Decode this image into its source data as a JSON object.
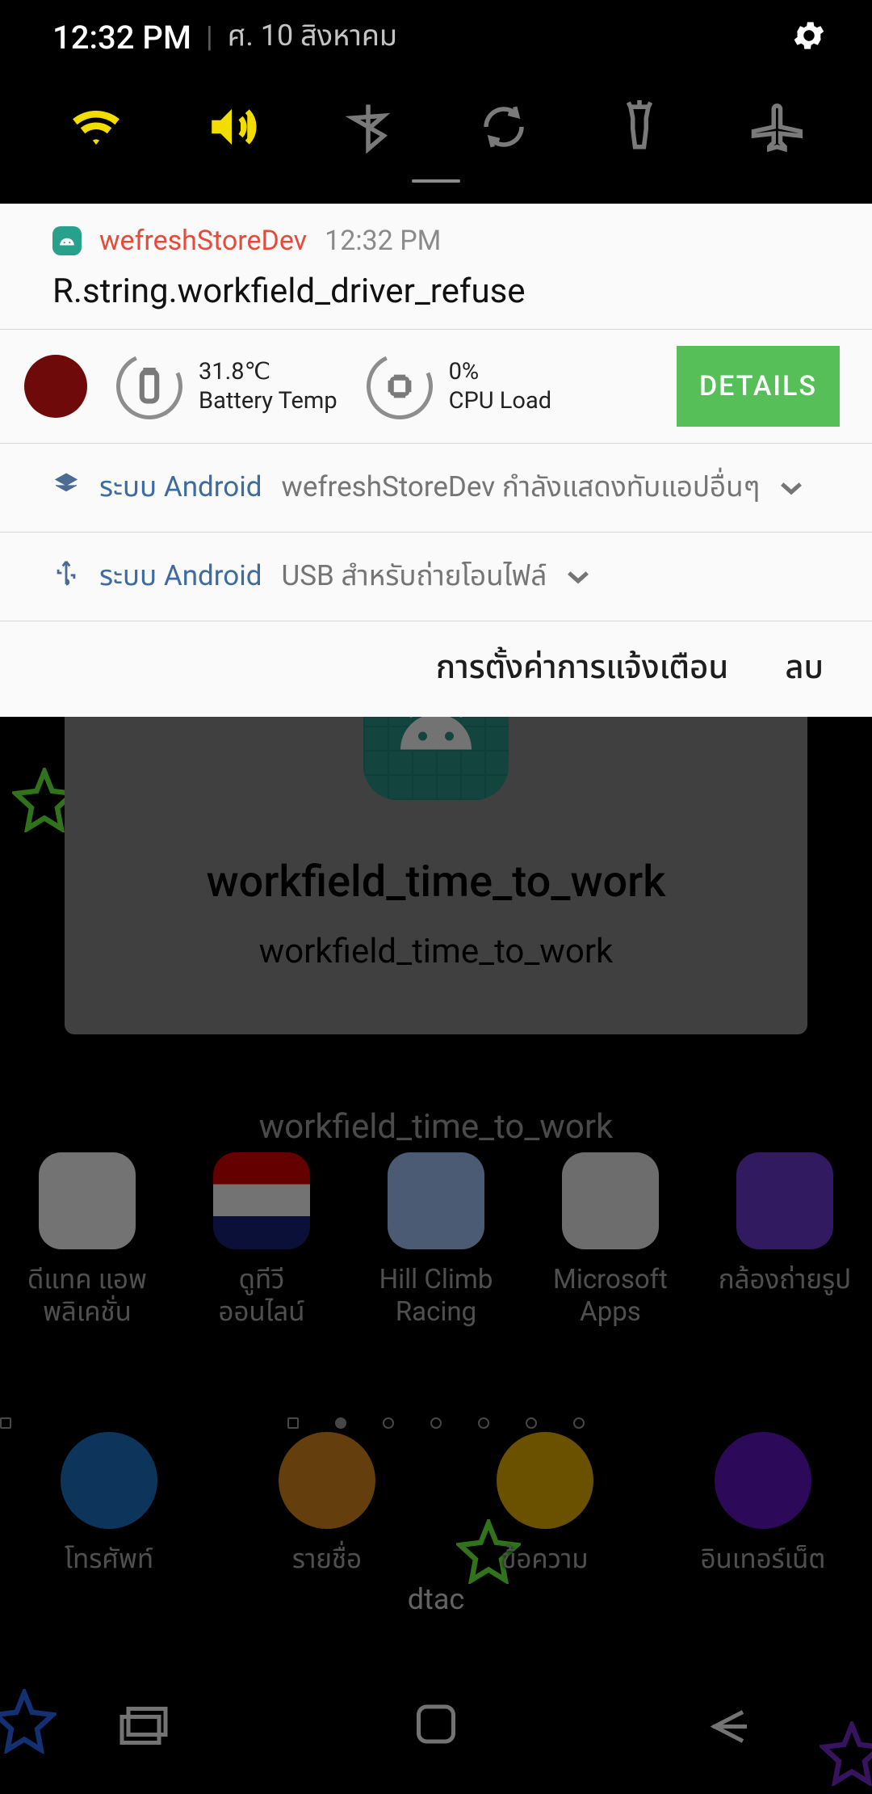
{
  "status": {
    "time": "12:32 PM",
    "date": "ศ. 10 สิงหาคม"
  },
  "qs": {
    "wifi": {
      "on": true
    },
    "sound": {
      "on": true
    },
    "bt": {
      "on": false
    },
    "rotate": {
      "on": false
    },
    "torch": {
      "on": false
    },
    "plane": {
      "on": false
    }
  },
  "notif1": {
    "app": "wefreshStoreDev",
    "time": "12:32 PM",
    "title": "R.string.workfield_driver_refuse"
  },
  "sysstat": {
    "temp_value": "31.8℃",
    "temp_label": "Battery Temp",
    "cpu_value": "0%",
    "cpu_label": "CPU Load",
    "button": "DETAILS"
  },
  "sys1": {
    "label": "ระบบ Android",
    "desc": "wefreshStoreDev กำลังแสดงทับแอปอื่นๆ"
  },
  "sys2": {
    "label": "ระบบ Android",
    "desc": "USB สำหรับถ่ายโอนไฟล์"
  },
  "footer": {
    "settings": "การตั้งค่าการแจ้งเตือน",
    "clear": "ลบ"
  },
  "dialog": {
    "title": "workfield_time_to_work",
    "sub": "workfield_time_to_work"
  },
  "results": "workfield_time_to_work",
  "apps": {
    "a1": "ดีแทค แอพ\nพลิเคชั่น",
    "a2": "ดูทีวี\nออนไลน์",
    "a3": "Hill Climb\nRacing",
    "a4": "Microsoft\nApps",
    "a5": "กล้องถ่ายรูป"
  },
  "dock": {
    "d1": "โทรศัพท์",
    "d2": "รายชื่อ",
    "d3": "ข้อความ",
    "d4": "อินเทอร์เน็ต"
  },
  "carrier": "dtac"
}
